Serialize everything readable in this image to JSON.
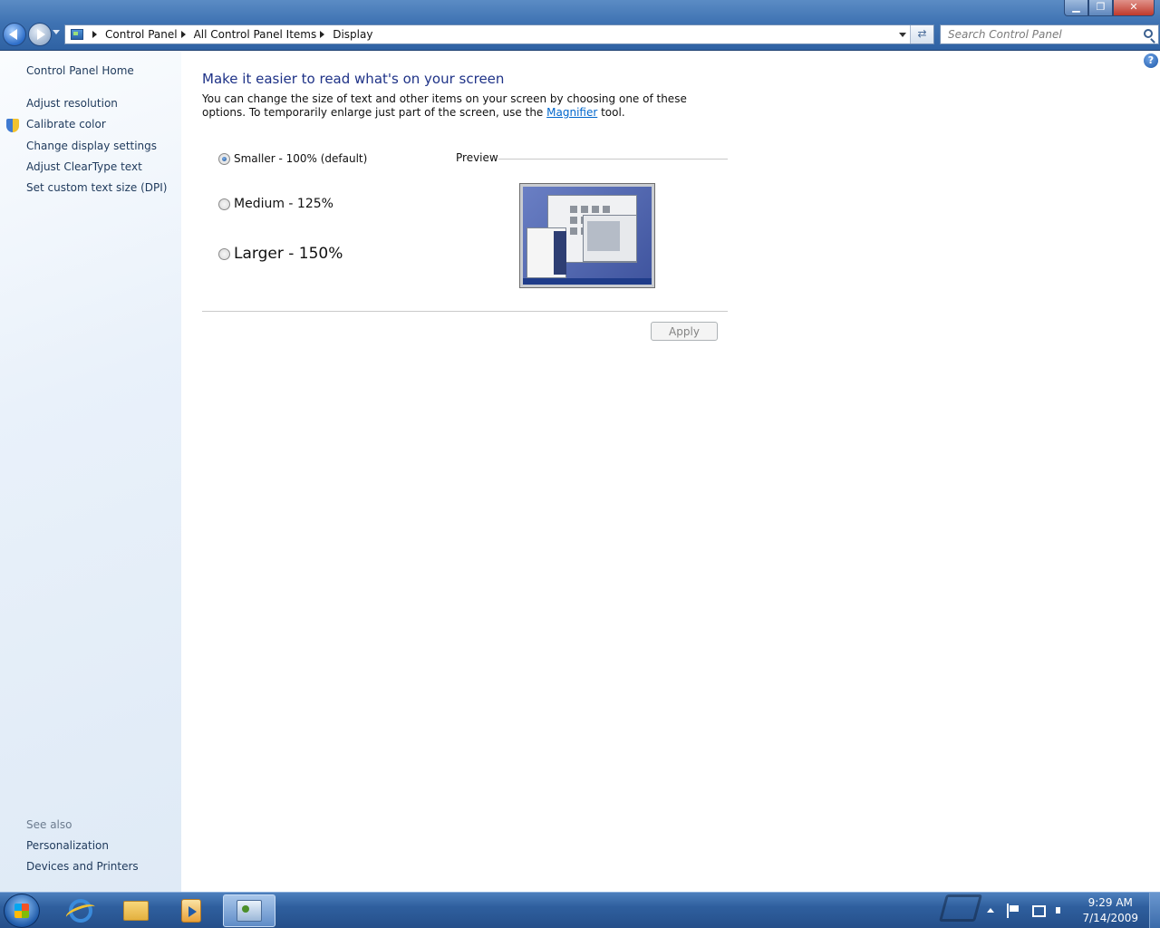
{
  "window": {
    "controls": {
      "minimize": "▁",
      "maximize": "❐",
      "close": "✕"
    }
  },
  "address": {
    "breadcrumbs": [
      "Control Panel",
      "All Control Panel Items",
      "Display"
    ],
    "refresh_glyph": "⇄"
  },
  "search": {
    "placeholder": "Search Control Panel"
  },
  "left_pane": {
    "home": "Control Panel Home",
    "tasks": [
      "Adjust resolution",
      "Calibrate color",
      "Change display settings",
      "Adjust ClearType text",
      "Set custom text size (DPI)"
    ],
    "see_also_heading": "See also",
    "see_also": [
      "Personalization",
      "Devices and Printers"
    ]
  },
  "main": {
    "help_glyph": "?",
    "title": "Make it easier to read what's on your screen",
    "description_part1": "You can change the size of text and other items on your screen by choosing one of these options. To temporarily enlarge just part of the screen, use the ",
    "magnifier_link": "Magnifier",
    "description_part2": " tool.",
    "options": [
      {
        "label": "Smaller - 100% (default)",
        "selected": true
      },
      {
        "label": "Medium - 125%",
        "selected": false
      },
      {
        "label": "Larger - 150%",
        "selected": false
      }
    ],
    "preview_label": "Preview",
    "apply_label": "Apply"
  },
  "taskbar": {
    "apps": [
      "start",
      "internet-explorer",
      "windows-explorer",
      "media-player",
      "control-panel"
    ],
    "clock_time": "9:29 AM",
    "clock_date": "7/14/2009"
  }
}
